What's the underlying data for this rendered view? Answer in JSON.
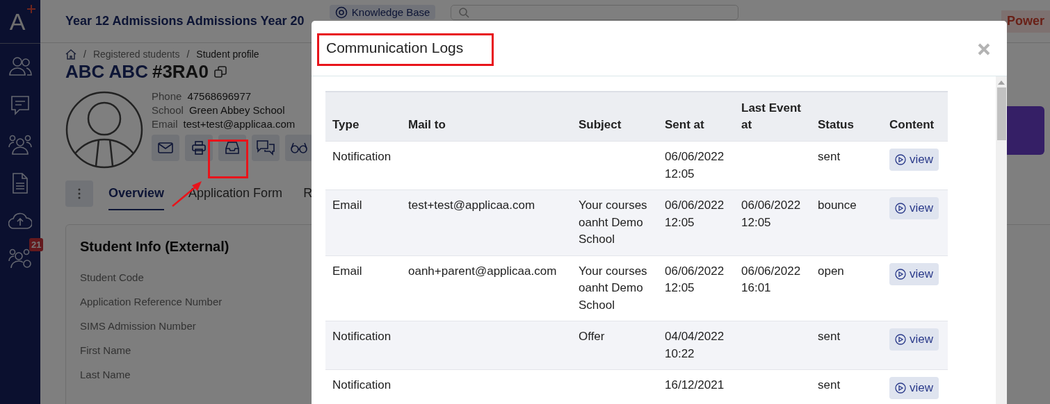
{
  "sidebar": {
    "logo": "A",
    "badge": "21"
  },
  "header": {
    "title": "Year 12 Admissions Admissions Year 20",
    "knowledge_base": "Knowledge Base",
    "power": "Power"
  },
  "breadcrumb": [
    {
      "separator": "/",
      "label": "Registered students"
    },
    {
      "separator": "/",
      "label": "Student profile"
    }
  ],
  "student": {
    "name": "ABC ABC",
    "code": "#3RA0",
    "info": [
      {
        "label": "Phone",
        "value": "47568696977"
      },
      {
        "label": "School",
        "value": "Green Abbey School"
      },
      {
        "label": "Email",
        "value": "test+test@applicaa.com"
      }
    ]
  },
  "tabs": [
    {
      "label": "Overview",
      "selected": true
    },
    {
      "label": "Application Form",
      "selected": false
    },
    {
      "label": "R",
      "selected": false
    }
  ],
  "card": {
    "title": "Student Info (External)",
    "fields": [
      "Student Code",
      "Application Reference Number",
      "SIMS Admission Number",
      "First Name",
      "Last Name"
    ]
  },
  "modal": {
    "title": "Communication Logs",
    "columns": [
      "Type",
      "Mail to",
      "Subject",
      "Sent at",
      "Last Event at",
      "Status",
      "Content"
    ],
    "rows": [
      {
        "type": "Notification",
        "mail_to": "",
        "subject": "",
        "sent_at": "06/06/2022 12:05",
        "last_event_at": "",
        "status": "sent",
        "content": "view"
      },
      {
        "type": "Email",
        "mail_to": "test+test@applicaa.com",
        "subject": "Your courses oanht Demo School",
        "sent_at": "06/06/2022 12:05",
        "last_event_at": "06/06/2022 12:05",
        "status": "bounce",
        "content": "view"
      },
      {
        "type": "Email",
        "mail_to": "oanh+parent@applicaa.com",
        "subject": "Your courses oanht Demo School",
        "sent_at": "06/06/2022 12:05",
        "last_event_at": "06/06/2022 16:01",
        "status": "open",
        "content": "view"
      },
      {
        "type": "Notification",
        "mail_to": "",
        "subject": "Offer",
        "sent_at": "04/04/2022 10:22",
        "last_event_at": "",
        "status": "sent",
        "content": "view"
      },
      {
        "type": "Notification",
        "mail_to": "",
        "subject": "",
        "sent_at": "16/12/2021",
        "last_event_at": "",
        "status": "sent",
        "content": "view"
      }
    ]
  }
}
